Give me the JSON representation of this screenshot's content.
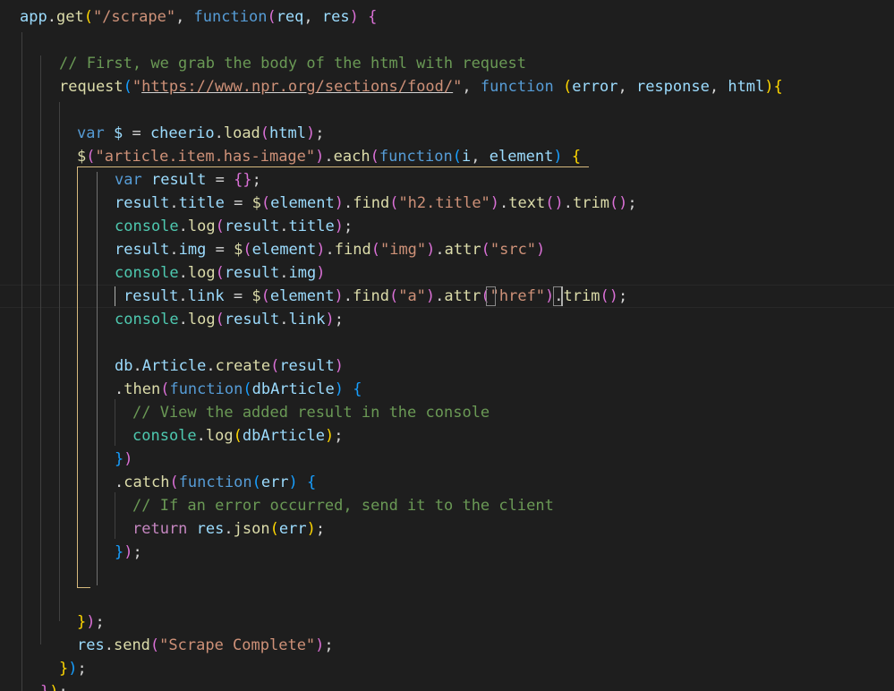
{
  "colors": {
    "background": "#1e1e1e",
    "default": "#d4d4d4",
    "keyword": "#569cd6",
    "string": "#ce9178",
    "comment": "#6a9955",
    "function": "#dcdcaa",
    "variable": "#9cdcfe",
    "type": "#4ec9b0",
    "bracket_gold": "#ffd700",
    "bracket_orchid": "#da70d6",
    "bracket_blue": "#179fff",
    "control": "#c586c0"
  },
  "code_lines": [
    [
      {
        "t": "app",
        "c": "variable"
      },
      {
        "t": ".",
        "c": "default"
      },
      {
        "t": "get",
        "c": "function"
      },
      {
        "t": "(",
        "c": "bracket_gold"
      },
      {
        "t": "\"/scrape\"",
        "c": "string"
      },
      {
        "t": ", ",
        "c": "default"
      },
      {
        "t": "function",
        "c": "keyword"
      },
      {
        "t": "(",
        "c": "bracket_orchid"
      },
      {
        "t": "req",
        "c": "variable"
      },
      {
        "t": ", ",
        "c": "default"
      },
      {
        "t": "res",
        "c": "variable"
      },
      {
        "t": ")",
        "c": "bracket_orchid"
      },
      {
        "t": " ",
        "c": "default"
      },
      {
        "t": "{",
        "c": "bracket_orchid"
      }
    ],
    [],
    [
      {
        "t": "// First, we grab the body of the html with request",
        "c": "comment"
      }
    ],
    [
      {
        "t": "request",
        "c": "function"
      },
      {
        "t": "(",
        "c": "bracket_blue"
      },
      {
        "t": "\"",
        "c": "string"
      },
      {
        "t": "https://www.npr.org/sections/food/",
        "c": "string",
        "u": true
      },
      {
        "t": "\"",
        "c": "string"
      },
      {
        "t": ", ",
        "c": "default"
      },
      {
        "t": "function",
        "c": "keyword"
      },
      {
        "t": " ",
        "c": "default"
      },
      {
        "t": "(",
        "c": "bracket_gold"
      },
      {
        "t": "error",
        "c": "variable"
      },
      {
        "t": ", ",
        "c": "default"
      },
      {
        "t": "response",
        "c": "variable"
      },
      {
        "t": ", ",
        "c": "default"
      },
      {
        "t": "html",
        "c": "variable"
      },
      {
        "t": ")",
        "c": "bracket_gold"
      },
      {
        "t": "{",
        "c": "bracket_gold"
      }
    ],
    [],
    [
      {
        "t": "var",
        "c": "keyword"
      },
      {
        "t": " ",
        "c": "default"
      },
      {
        "t": "$",
        "c": "variable"
      },
      {
        "t": " = ",
        "c": "default"
      },
      {
        "t": "cheerio",
        "c": "variable"
      },
      {
        "t": ".",
        "c": "default"
      },
      {
        "t": "load",
        "c": "function"
      },
      {
        "t": "(",
        "c": "bracket_orchid"
      },
      {
        "t": "html",
        "c": "variable"
      },
      {
        "t": ")",
        "c": "bracket_orchid"
      },
      {
        "t": ";",
        "c": "default"
      }
    ],
    [
      {
        "t": "$",
        "c": "function"
      },
      {
        "t": "(",
        "c": "bracket_orchid"
      },
      {
        "t": "\"article.item.has-image\"",
        "c": "string"
      },
      {
        "t": ")",
        "c": "bracket_orchid"
      },
      {
        "t": ".",
        "c": "default"
      },
      {
        "t": "each",
        "c": "function"
      },
      {
        "t": "(",
        "c": "bracket_orchid"
      },
      {
        "t": "function",
        "c": "keyword"
      },
      {
        "t": "(",
        "c": "bracket_blue"
      },
      {
        "t": "i",
        "c": "variable"
      },
      {
        "t": ", ",
        "c": "default"
      },
      {
        "t": "element",
        "c": "variable"
      },
      {
        "t": ")",
        "c": "bracket_blue"
      },
      {
        "t": " ",
        "c": "default"
      },
      {
        "t": "{",
        "c": "bracket_gold"
      }
    ],
    [
      {
        "t": "var",
        "c": "keyword"
      },
      {
        "t": " ",
        "c": "default"
      },
      {
        "t": "result",
        "c": "variable"
      },
      {
        "t": " = ",
        "c": "default"
      },
      {
        "t": "{}",
        "c": "bracket_orchid"
      },
      {
        "t": ";",
        "c": "default"
      }
    ],
    [
      {
        "t": "result",
        "c": "variable"
      },
      {
        "t": ".",
        "c": "default"
      },
      {
        "t": "title",
        "c": "variable"
      },
      {
        "t": " = ",
        "c": "default"
      },
      {
        "t": "$",
        "c": "function"
      },
      {
        "t": "(",
        "c": "bracket_orchid"
      },
      {
        "t": "element",
        "c": "variable"
      },
      {
        "t": ")",
        "c": "bracket_orchid"
      },
      {
        "t": ".",
        "c": "default"
      },
      {
        "t": "find",
        "c": "function"
      },
      {
        "t": "(",
        "c": "bracket_orchid"
      },
      {
        "t": "\"h2.title\"",
        "c": "string"
      },
      {
        "t": ")",
        "c": "bracket_orchid"
      },
      {
        "t": ".",
        "c": "default"
      },
      {
        "t": "text",
        "c": "function"
      },
      {
        "t": "()",
        "c": "bracket_orchid"
      },
      {
        "t": ".",
        "c": "default"
      },
      {
        "t": "trim",
        "c": "function"
      },
      {
        "t": "()",
        "c": "bracket_orchid"
      },
      {
        "t": ";",
        "c": "default"
      }
    ],
    [
      {
        "t": "console",
        "c": "type"
      },
      {
        "t": ".",
        "c": "default"
      },
      {
        "t": "log",
        "c": "function"
      },
      {
        "t": "(",
        "c": "bracket_orchid"
      },
      {
        "t": "result",
        "c": "variable"
      },
      {
        "t": ".",
        "c": "default"
      },
      {
        "t": "title",
        "c": "variable"
      },
      {
        "t": ")",
        "c": "bracket_orchid"
      },
      {
        "t": ";",
        "c": "default"
      }
    ],
    [
      {
        "t": "result",
        "c": "variable"
      },
      {
        "t": ".",
        "c": "default"
      },
      {
        "t": "img",
        "c": "variable"
      },
      {
        "t": " = ",
        "c": "default"
      },
      {
        "t": "$",
        "c": "function"
      },
      {
        "t": "(",
        "c": "bracket_orchid"
      },
      {
        "t": "element",
        "c": "variable"
      },
      {
        "t": ")",
        "c": "bracket_orchid"
      },
      {
        "t": ".",
        "c": "default"
      },
      {
        "t": "find",
        "c": "function"
      },
      {
        "t": "(",
        "c": "bracket_orchid"
      },
      {
        "t": "\"img\"",
        "c": "string"
      },
      {
        "t": ")",
        "c": "bracket_orchid"
      },
      {
        "t": ".",
        "c": "default"
      },
      {
        "t": "attr",
        "c": "function"
      },
      {
        "t": "(",
        "c": "bracket_orchid"
      },
      {
        "t": "\"src\"",
        "c": "string"
      },
      {
        "t": ")",
        "c": "bracket_orchid"
      }
    ],
    [
      {
        "t": "console",
        "c": "type"
      },
      {
        "t": ".",
        "c": "default"
      },
      {
        "t": "log",
        "c": "function"
      },
      {
        "t": "(",
        "c": "bracket_orchid"
      },
      {
        "t": "result",
        "c": "variable"
      },
      {
        "t": ".",
        "c": "default"
      },
      {
        "t": "img",
        "c": "variable"
      },
      {
        "t": ")",
        "c": "bracket_orchid"
      }
    ],
    [
      {
        "t": "result",
        "c": "variable"
      },
      {
        "t": ".",
        "c": "default"
      },
      {
        "t": "link",
        "c": "variable"
      },
      {
        "t": " = ",
        "c": "default"
      },
      {
        "t": "$",
        "c": "function"
      },
      {
        "t": "(",
        "c": "bracket_orchid"
      },
      {
        "t": "element",
        "c": "variable"
      },
      {
        "t": ")",
        "c": "bracket_orchid"
      },
      {
        "t": ".",
        "c": "default"
      },
      {
        "t": "find",
        "c": "function"
      },
      {
        "t": "(",
        "c": "bracket_orchid"
      },
      {
        "t": "\"a\"",
        "c": "string"
      },
      {
        "t": ")",
        "c": "bracket_orchid"
      },
      {
        "t": ".",
        "c": "default"
      },
      {
        "t": "attr",
        "c": "function"
      },
      {
        "t": "(",
        "c": "bracket_orchid"
      },
      {
        "t": "\"href\"",
        "c": "string"
      },
      {
        "t": ")",
        "c": "bracket_orchid"
      },
      {
        "t": ".",
        "c": "default"
      },
      {
        "t": "trim",
        "c": "function"
      },
      {
        "t": "()",
        "c": "bracket_orchid"
      },
      {
        "t": ";",
        "c": "default"
      }
    ],
    [
      {
        "t": "console",
        "c": "type"
      },
      {
        "t": ".",
        "c": "default"
      },
      {
        "t": "log",
        "c": "function"
      },
      {
        "t": "(",
        "c": "bracket_orchid"
      },
      {
        "t": "result",
        "c": "variable"
      },
      {
        "t": ".",
        "c": "default"
      },
      {
        "t": "link",
        "c": "variable"
      },
      {
        "t": ")",
        "c": "bracket_orchid"
      },
      {
        "t": ";",
        "c": "default"
      }
    ],
    [],
    [
      {
        "t": "db",
        "c": "variable"
      },
      {
        "t": ".",
        "c": "default"
      },
      {
        "t": "Article",
        "c": "variable"
      },
      {
        "t": ".",
        "c": "default"
      },
      {
        "t": "create",
        "c": "function"
      },
      {
        "t": "(",
        "c": "bracket_orchid"
      },
      {
        "t": "result",
        "c": "variable"
      },
      {
        "t": ")",
        "c": "bracket_orchid"
      }
    ],
    [
      {
        "t": ".",
        "c": "default"
      },
      {
        "t": "then",
        "c": "function"
      },
      {
        "t": "(",
        "c": "bracket_orchid"
      },
      {
        "t": "function",
        "c": "keyword"
      },
      {
        "t": "(",
        "c": "bracket_blue"
      },
      {
        "t": "dbArticle",
        "c": "variable"
      },
      {
        "t": ")",
        "c": "bracket_blue"
      },
      {
        "t": " ",
        "c": "default"
      },
      {
        "t": "{",
        "c": "bracket_blue"
      }
    ],
    [
      {
        "t": "// View the added result in the console",
        "c": "comment"
      }
    ],
    [
      {
        "t": "console",
        "c": "type"
      },
      {
        "t": ".",
        "c": "default"
      },
      {
        "t": "log",
        "c": "function"
      },
      {
        "t": "(",
        "c": "bracket_gold"
      },
      {
        "t": "dbArticle",
        "c": "variable"
      },
      {
        "t": ")",
        "c": "bracket_gold"
      },
      {
        "t": ";",
        "c": "default"
      }
    ],
    [
      {
        "t": "}",
        "c": "bracket_blue"
      },
      {
        "t": ")",
        "c": "bracket_orchid"
      }
    ],
    [
      {
        "t": ".",
        "c": "default"
      },
      {
        "t": "catch",
        "c": "function"
      },
      {
        "t": "(",
        "c": "bracket_orchid"
      },
      {
        "t": "function",
        "c": "keyword"
      },
      {
        "t": "(",
        "c": "bracket_blue"
      },
      {
        "t": "err",
        "c": "variable"
      },
      {
        "t": ")",
        "c": "bracket_blue"
      },
      {
        "t": " ",
        "c": "default"
      },
      {
        "t": "{",
        "c": "bracket_blue"
      }
    ],
    [
      {
        "t": "// If an error occurred, send it to the client",
        "c": "comment"
      }
    ],
    [
      {
        "t": "return",
        "c": "control"
      },
      {
        "t": " ",
        "c": "default"
      },
      {
        "t": "res",
        "c": "variable"
      },
      {
        "t": ".",
        "c": "default"
      },
      {
        "t": "json",
        "c": "function"
      },
      {
        "t": "(",
        "c": "bracket_gold"
      },
      {
        "t": "err",
        "c": "variable"
      },
      {
        "t": ")",
        "c": "bracket_gold"
      },
      {
        "t": ";",
        "c": "default"
      }
    ],
    [
      {
        "t": "}",
        "c": "bracket_blue"
      },
      {
        "t": ")",
        "c": "bracket_orchid"
      },
      {
        "t": ";",
        "c": "default"
      }
    ],
    [],
    [],
    [
      {
        "t": "}",
        "c": "bracket_gold"
      },
      {
        "t": ")",
        "c": "bracket_orchid"
      },
      {
        "t": ";",
        "c": "default"
      }
    ],
    [
      {
        "t": "res",
        "c": "variable"
      },
      {
        "t": ".",
        "c": "default"
      },
      {
        "t": "send",
        "c": "function"
      },
      {
        "t": "(",
        "c": "bracket_orchid"
      },
      {
        "t": "\"Scrape Complete\"",
        "c": "string"
      },
      {
        "t": ")",
        "c": "bracket_orchid"
      },
      {
        "t": ";",
        "c": "default"
      }
    ],
    [
      {
        "t": "}",
        "c": "bracket_gold"
      },
      {
        "t": ")",
        "c": "bracket_blue"
      },
      {
        "t": ";",
        "c": "default"
      }
    ],
    [
      {
        "t": "}",
        "c": "bracket_orchid"
      },
      {
        "t": ")",
        "c": "bracket_gold"
      },
      {
        "t": ";",
        "c": "default"
      }
    ]
  ]
}
